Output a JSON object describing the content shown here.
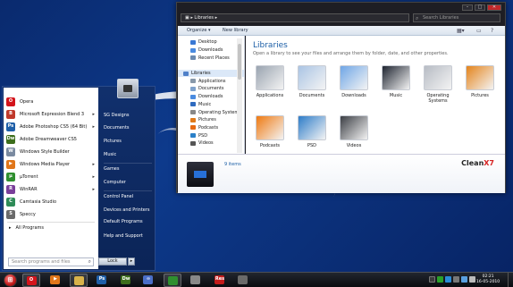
{
  "explorer": {
    "breadcrumb": "Libraries",
    "search_placeholder": "Search Libraries",
    "toolbar": {
      "organize": "Organize ▾",
      "new_library": "New library"
    },
    "nav": [
      {
        "label": "Desktop",
        "sub": true,
        "color": "#3a79d4"
      },
      {
        "label": "Downloads",
        "sub": true,
        "color": "#4a8be0"
      },
      {
        "label": "Recent Places",
        "sub": true,
        "color": "#6b8ab0"
      },
      {
        "label": "",
        "sub": false,
        "color": "transparent"
      },
      {
        "label": "Libraries",
        "sub": false,
        "sel": true,
        "color": "#4f80c8"
      },
      {
        "label": "Applications",
        "sub": true,
        "color": "#8899aa"
      },
      {
        "label": "Documents",
        "sub": true,
        "color": "#7fa2cc"
      },
      {
        "label": "Downloads",
        "sub": true,
        "color": "#4a8be0"
      },
      {
        "label": "Music",
        "sub": true,
        "color": "#2f6bbf"
      },
      {
        "label": "Operating Systems",
        "sub": true,
        "color": "#888"
      },
      {
        "label": "Pictures",
        "sub": true,
        "color": "#e07a1a"
      },
      {
        "label": "Podcasts",
        "sub": true,
        "color": "#e66a12"
      },
      {
        "label": "PSD",
        "sub": true,
        "color": "#2a80c8"
      },
      {
        "label": "Videos",
        "sub": true,
        "color": "#555"
      }
    ],
    "title": "Libraries",
    "subtitle": "Open a library to see your files and arrange them by folder, date, and other properties.",
    "tiles": [
      {
        "label": "Applications",
        "color": "#9aa4b0"
      },
      {
        "label": "Documents",
        "color": "#aac4e4"
      },
      {
        "label": "Downloads",
        "color": "#6fa6e6"
      },
      {
        "label": "Music",
        "color": "#1e2430"
      },
      {
        "label": "Operating Systems",
        "color": "#b7bcc4"
      },
      {
        "label": "Pictures",
        "color": "#e4841c"
      },
      {
        "label": "Podcasts",
        "color": "#ef7a12"
      },
      {
        "label": "PSD",
        "color": "#2d7cc8"
      },
      {
        "label": "Videos",
        "color": "#3b3e44"
      }
    ],
    "details": {
      "count": "9 items",
      "brand_a": "Clean",
      "brand_b": "X7"
    }
  },
  "start_menu": {
    "programs": [
      {
        "label": "Opera",
        "color": "#d3141b",
        "glyph": "O",
        "arrow": false
      },
      {
        "label": "Microsoft Expression Blend 3",
        "color": "#c0392b",
        "glyph": "B",
        "arrow": true
      },
      {
        "label": "Adobe Photoshop CS5 (64 Bit)",
        "color": "#1f5fa8",
        "glyph": "Ps",
        "arrow": true
      },
      {
        "label": "Adobe Dreamweaver CS5",
        "color": "#3d6e1c",
        "glyph": "Dw",
        "arrow": false
      },
      {
        "label": "Windows Style Builder",
        "color": "#7a8aa0",
        "glyph": "W",
        "arrow": false
      },
      {
        "label": "Windows Media Player",
        "color": "#e0761a",
        "glyph": "▶",
        "arrow": true
      },
      {
        "label": "µTorrent",
        "color": "#2f8f2f",
        "glyph": "µ",
        "arrow": true
      },
      {
        "label": "WinRAR",
        "color": "#7a3f9a",
        "glyph": "R",
        "arrow": true
      },
      {
        "label": "Camtasia Studio",
        "color": "#2e8b57",
        "glyph": "C",
        "arrow": false
      },
      {
        "label": "Speccy",
        "color": "#6a6a6a",
        "glyph": "S",
        "arrow": false
      }
    ],
    "all_programs": "All Programs",
    "search_placeholder": "Search programs and files",
    "links": [
      "SG Designs",
      "Documents",
      "Pictures",
      "Music",
      "Games",
      "Computer",
      "Control Panel",
      "Devices and Printers",
      "Default Programs",
      "Help and Support"
    ],
    "lock": "Lock"
  },
  "taskbar": {
    "apps": [
      {
        "color": "#d3141b",
        "glyph": "O",
        "active": true
      },
      {
        "color": "#e0761a",
        "glyph": "▶",
        "active": false
      },
      {
        "color": "#d8b24a",
        "glyph": "",
        "active": true
      },
      {
        "color": "#1f5fa8",
        "glyph": "Ps",
        "active": false
      },
      {
        "color": "#3d6e1c",
        "glyph": "Dw",
        "active": false
      },
      {
        "color": "#4a6ec8",
        "glyph": "∞",
        "active": false
      },
      {
        "color": "#2f8f2f",
        "glyph": "",
        "active": true
      },
      {
        "color": "#888888",
        "glyph": "",
        "active": false
      },
      {
        "color": "#c21b1b",
        "glyph": "Res",
        "active": false
      },
      {
        "color": "#6a6a6a",
        "glyph": "",
        "active": false
      }
    ],
    "time": "02:21",
    "date": "16-05-2010"
  }
}
